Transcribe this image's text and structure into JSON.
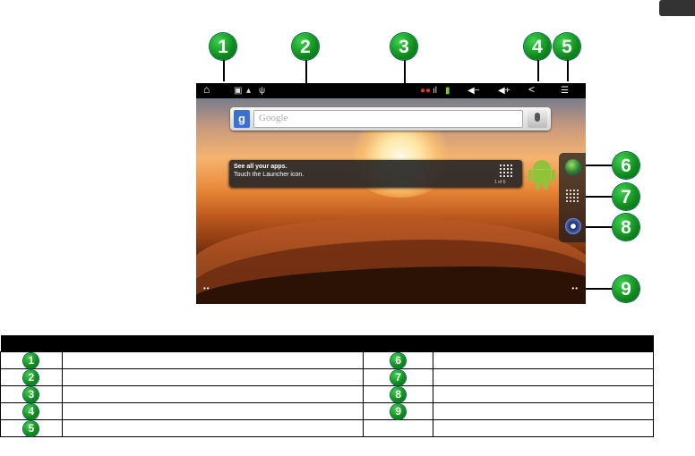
{
  "screen": {
    "search_placeholder": "Google",
    "google_letter": "g",
    "tip_title": "See all your apps.",
    "tip_body": "Touch the Launcher icon.",
    "tip_page": "1 of 6",
    "page_dots_left": "••",
    "page_dots_right": "••"
  },
  "callouts": [
    "1",
    "2",
    "3",
    "4",
    "5",
    "6",
    "7",
    "8",
    "9"
  ],
  "legend": {
    "rows": [
      {
        "left": "1",
        "right": "6"
      },
      {
        "left": "2",
        "right": "7"
      },
      {
        "left": "3",
        "right": "8"
      },
      {
        "left": "4",
        "right": "9"
      },
      {
        "left": "5",
        "right": ""
      }
    ]
  },
  "colors": {
    "callout": "#12a02a",
    "status_bar": "#000000",
    "header": "#000000"
  },
  "icons": [
    "home-icon",
    "back-icon",
    "menu-icon",
    "volume-down-icon",
    "volume-up-icon",
    "microphone-icon",
    "google-icon",
    "android-icon",
    "globe-icon",
    "apps-grid-icon",
    "settings-icon"
  ]
}
